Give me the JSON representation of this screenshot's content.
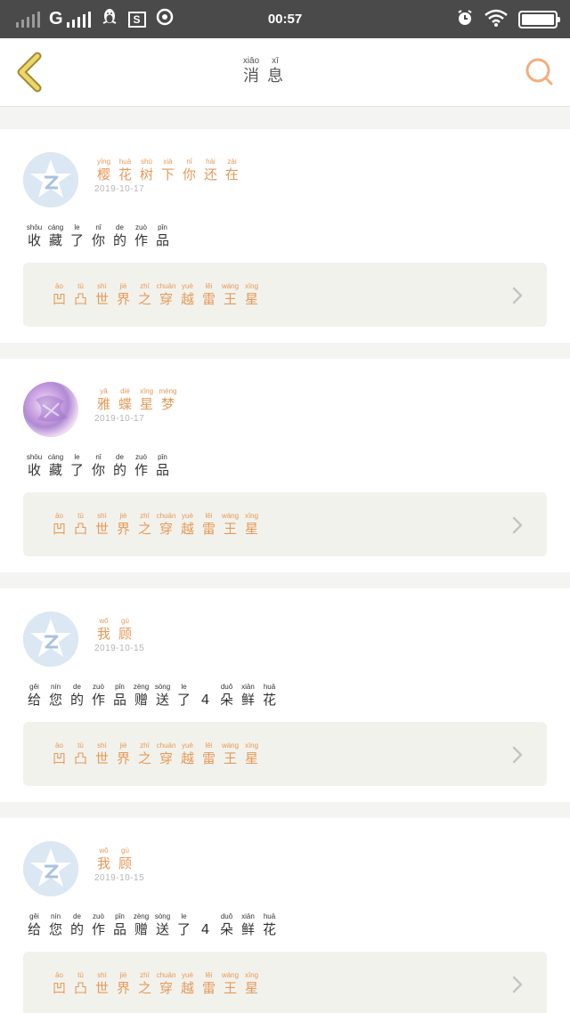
{
  "status_bar": {
    "carrier": "G",
    "time": "00:57",
    "icons": [
      "signal-icon-dim",
      "signal-icon",
      "penguin-icon",
      "s-app-icon",
      "weibo-icon",
      "alarm-icon",
      "wifi-icon",
      "battery-icon"
    ],
    "s_label": "S"
  },
  "header": {
    "title": [
      {
        "py": "xiāo",
        "ch": "消"
      },
      {
        "py": "xī",
        "ch": "息"
      }
    ],
    "back_icon": "back-chevron-icon",
    "search_icon": "search-icon",
    "accent_color": "#e8b13a",
    "search_color": "#f2ae7d"
  },
  "notifications": [
    {
      "avatar": "qq-default-avatar",
      "username": [
        {
          "py": "yīng",
          "ch": "樱"
        },
        {
          "py": "huā",
          "ch": "花"
        },
        {
          "py": "shù",
          "ch": "树"
        },
        {
          "py": "xià",
          "ch": "下"
        },
        {
          "py": "nǐ",
          "ch": "你"
        },
        {
          "py": "hái",
          "ch": "还"
        },
        {
          "py": "zài",
          "ch": "在"
        }
      ],
      "date": "2019-10-17",
      "message": [
        {
          "py": "shōu",
          "ch": "收"
        },
        {
          "py": "cáng",
          "ch": "藏"
        },
        {
          "py": "le",
          "ch": "了"
        },
        {
          "py": "nǐ",
          "ch": "你"
        },
        {
          "py": "de",
          "ch": "的"
        },
        {
          "py": "zuò",
          "ch": "作"
        },
        {
          "py": "pǐn",
          "ch": "品"
        }
      ],
      "work_title": [
        {
          "py": "āo",
          "ch": "凹"
        },
        {
          "py": "tū",
          "ch": "凸"
        },
        {
          "py": "shì",
          "ch": "世"
        },
        {
          "py": "jiè",
          "ch": "界"
        },
        {
          "py": "zhī",
          "ch": "之"
        },
        {
          "py": "chuān",
          "ch": "穿"
        },
        {
          "py": "yuè",
          "ch": "越"
        },
        {
          "py": "lěi",
          "ch": "雷"
        },
        {
          "py": "wáng",
          "ch": "王"
        },
        {
          "py": "xīng",
          "ch": "星"
        }
      ]
    },
    {
      "avatar": "photo-avatar",
      "username": [
        {
          "py": "yǎ",
          "ch": "雅"
        },
        {
          "py": "dié",
          "ch": "蝶"
        },
        {
          "py": "xīng",
          "ch": "星"
        },
        {
          "py": "mèng",
          "ch": "梦"
        }
      ],
      "date": "2019-10-17",
      "message": [
        {
          "py": "shōu",
          "ch": "收"
        },
        {
          "py": "cáng",
          "ch": "藏"
        },
        {
          "py": "le",
          "ch": "了"
        },
        {
          "py": "nǐ",
          "ch": "你"
        },
        {
          "py": "de",
          "ch": "的"
        },
        {
          "py": "zuò",
          "ch": "作"
        },
        {
          "py": "pǐn",
          "ch": "品"
        }
      ],
      "work_title": [
        {
          "py": "āo",
          "ch": "凹"
        },
        {
          "py": "tū",
          "ch": "凸"
        },
        {
          "py": "shì",
          "ch": "世"
        },
        {
          "py": "jiè",
          "ch": "界"
        },
        {
          "py": "zhī",
          "ch": "之"
        },
        {
          "py": "chuān",
          "ch": "穿"
        },
        {
          "py": "yuè",
          "ch": "越"
        },
        {
          "py": "lěi",
          "ch": "雷"
        },
        {
          "py": "wáng",
          "ch": "王"
        },
        {
          "py": "xīng",
          "ch": "星"
        }
      ]
    },
    {
      "avatar": "qq-default-avatar",
      "username": [
        {
          "py": "wǒ",
          "ch": "我"
        },
        {
          "py": "gù",
          "ch": "顾"
        }
      ],
      "date": "2019-10-15",
      "message": [
        {
          "py": "gěi",
          "ch": "给"
        },
        {
          "py": "nín",
          "ch": "您"
        },
        {
          "py": "de",
          "ch": "的"
        },
        {
          "py": "zuò",
          "ch": "作"
        },
        {
          "py": "pǐn",
          "ch": "品"
        },
        {
          "py": "zèng",
          "ch": "赠"
        },
        {
          "py": "sòng",
          "ch": "送"
        },
        {
          "py": "le",
          "ch": "了"
        },
        {
          "py": "",
          "ch": "4"
        },
        {
          "py": "duǒ",
          "ch": "朵"
        },
        {
          "py": "xiān",
          "ch": "鲜"
        },
        {
          "py": "huā",
          "ch": "花"
        }
      ],
      "work_title": [
        {
          "py": "āo",
          "ch": "凹"
        },
        {
          "py": "tū",
          "ch": "凸"
        },
        {
          "py": "shì",
          "ch": "世"
        },
        {
          "py": "jiè",
          "ch": "界"
        },
        {
          "py": "zhī",
          "ch": "之"
        },
        {
          "py": "chuān",
          "ch": "穿"
        },
        {
          "py": "yuè",
          "ch": "越"
        },
        {
          "py": "lěi",
          "ch": "雷"
        },
        {
          "py": "wáng",
          "ch": "王"
        },
        {
          "py": "xīng",
          "ch": "星"
        }
      ]
    },
    {
      "avatar": "qq-default-avatar",
      "username": [
        {
          "py": "wǒ",
          "ch": "我"
        },
        {
          "py": "gù",
          "ch": "顾"
        }
      ],
      "date": "2019-10-15",
      "message": [
        {
          "py": "gěi",
          "ch": "给"
        },
        {
          "py": "nín",
          "ch": "您"
        },
        {
          "py": "de",
          "ch": "的"
        },
        {
          "py": "zuò",
          "ch": "作"
        },
        {
          "py": "pǐn",
          "ch": "品"
        },
        {
          "py": "zèng",
          "ch": "赠"
        },
        {
          "py": "sòng",
          "ch": "送"
        },
        {
          "py": "le",
          "ch": "了"
        },
        {
          "py": "",
          "ch": "4"
        },
        {
          "py": "duǒ",
          "ch": "朵"
        },
        {
          "py": "xiān",
          "ch": "鲜"
        },
        {
          "py": "huā",
          "ch": "花"
        }
      ],
      "work_title": [
        {
          "py": "āo",
          "ch": "凹"
        },
        {
          "py": "tū",
          "ch": "凸"
        },
        {
          "py": "shì",
          "ch": "世"
        },
        {
          "py": "jiè",
          "ch": "界"
        },
        {
          "py": "zhī",
          "ch": "之"
        },
        {
          "py": "chuān",
          "ch": "穿"
        },
        {
          "py": "yuè",
          "ch": "越"
        },
        {
          "py": "lěi",
          "ch": "雷"
        },
        {
          "py": "wáng",
          "ch": "王"
        },
        {
          "py": "xīng",
          "ch": "星"
        }
      ]
    }
  ]
}
